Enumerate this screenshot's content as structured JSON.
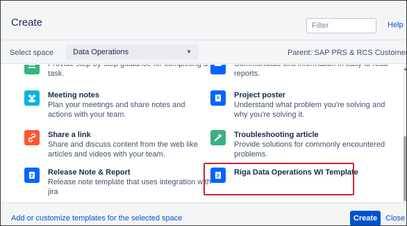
{
  "header": {
    "title": "Create",
    "filter_placeholder": "Filter",
    "help_label": "Help"
  },
  "space_bar": {
    "label": "Select space",
    "selected": "Data Operations",
    "parent": "Parent: SAP PRS & RCS Customer Ma..."
  },
  "templates": [
    {
      "name": "",
      "description": "Provide step-by-step guidance for completing a task.",
      "icon": "list-steps-icon",
      "color": "#36b37e"
    },
    {
      "name": "",
      "description": "Communicate Jira information in easy to read reports.",
      "icon": "jira-report-icon",
      "color": "#0065ff"
    },
    {
      "name": "Meeting notes",
      "description": "Plan your meetings and share notes and actions with your team.",
      "icon": "people-icon",
      "color": "#00b8d9"
    },
    {
      "name": "Project poster",
      "description": "Understand what problem you're solving and why you're solving it.",
      "icon": "poster-icon",
      "color": "#0065ff"
    },
    {
      "name": "Share a link",
      "description": "Share and discuss content from the web like articles and videos with your team.",
      "icon": "link-icon",
      "color": "#ff5630"
    },
    {
      "name": "Troubleshooting article",
      "description": "Provide solutions for commonly encountered problems.",
      "icon": "wrench-icon",
      "color": "#36b37e"
    },
    {
      "name": "Release Note & Report",
      "description": "Release note template that uses integration with jira",
      "icon": "document-icon",
      "color": "#0065ff"
    },
    {
      "name": "Riga Data Operations WI Template",
      "description": "",
      "icon": "document-icon",
      "color": "#0065ff"
    }
  ],
  "footer": {
    "customize_link": "Add or customize templates for the selected space",
    "create_label": "Create",
    "close_label": "Close"
  }
}
